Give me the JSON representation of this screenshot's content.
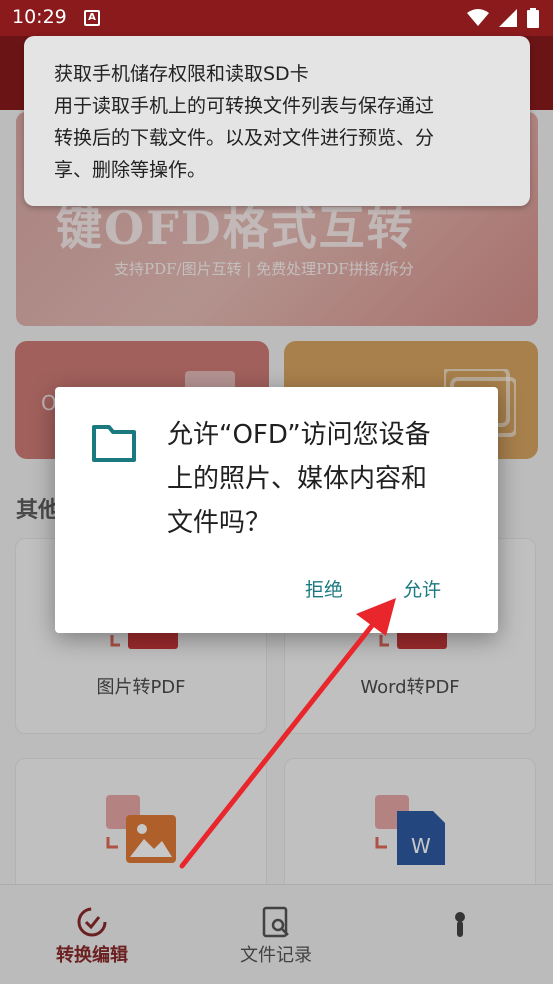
{
  "status_bar": {
    "time": "10:29",
    "app_glyph": "A"
  },
  "banner": {
    "headline": "键OFD格式互转",
    "subline": "支持PDF/图片互转 | 免费处理PDF拼接/拆分"
  },
  "cards": {
    "left_partial_label": "O"
  },
  "section": {
    "title": "其他"
  },
  "tiles": [
    {
      "label": "图片转PDF"
    },
    {
      "label": "Word转PDF"
    },
    {
      "label": ""
    },
    {
      "label": ""
    }
  ],
  "permission_tip": {
    "title": "获取手机储存权限和读取SD卡",
    "body_lines": [
      " 用于读取手机上的可转换文件列表与保存通过",
      "转换后的下载文件。以及对文件进行预览、分",
      "享、删除等操作。"
    ]
  },
  "dialog": {
    "message_lines": [
      "允许“OFD”访问您设备",
      "上的照片、媒体内容和",
      "文件吗？"
    ],
    "deny_label": "拒绝",
    "allow_label": "允许"
  },
  "bottom_nav": [
    {
      "label": "转换编辑",
      "icon": "convert-icon",
      "active": true
    },
    {
      "label": "文件记录",
      "icon": "file-search-icon",
      "active": false
    },
    {
      "label": "",
      "icon": "profile-icon",
      "active": false
    }
  ],
  "colors": {
    "accent": "#8a1a1c",
    "dialog_button": "#1b7a80",
    "arrow": "#e8262c"
  }
}
